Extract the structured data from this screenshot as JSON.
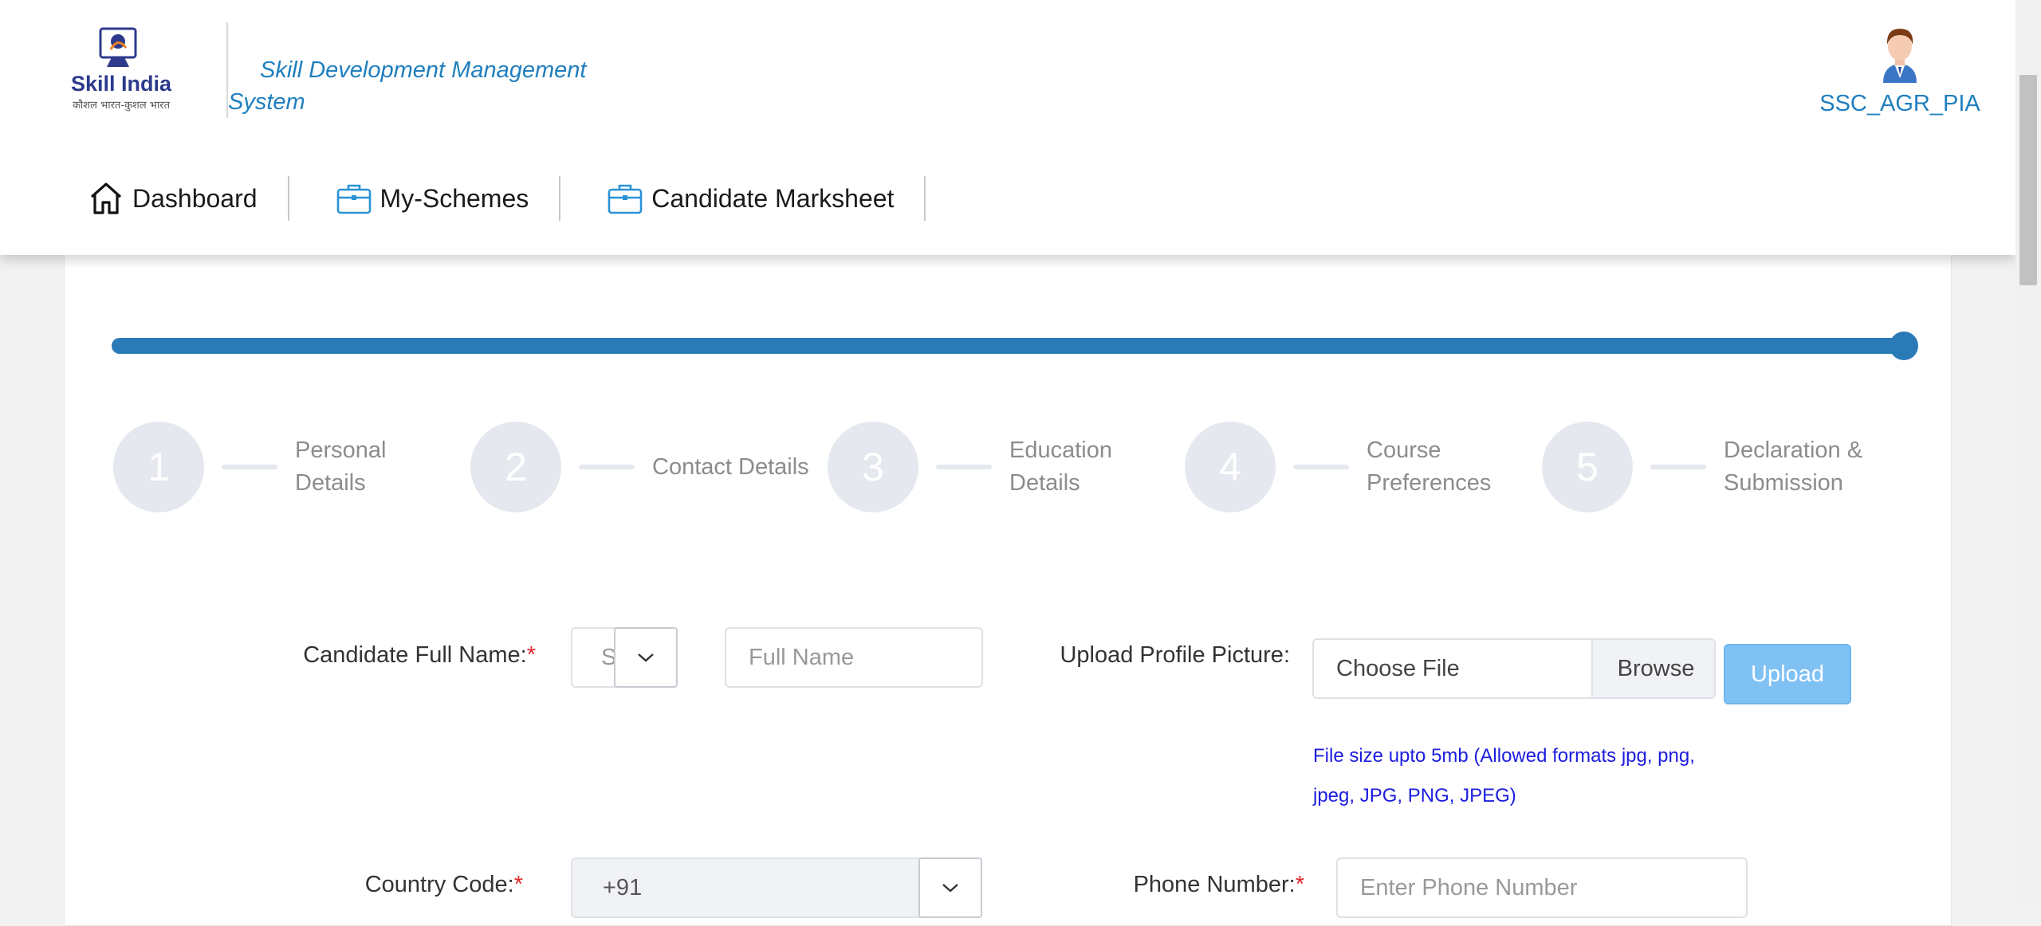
{
  "header": {
    "app_title": "Skill Development Management System",
    "logo_text": "Skill India",
    "logo_subtext": "कौशल भारत-कुशल भारत",
    "user_name": "SSC_AGR_PIA"
  },
  "nav": {
    "items": [
      {
        "label": "Dashboard",
        "icon": "home-icon"
      },
      {
        "label": "My-Schemes",
        "icon": "briefcase-icon"
      },
      {
        "label": "Candidate Marksheet",
        "icon": "briefcase-icon"
      }
    ]
  },
  "progress": {
    "percent": 100
  },
  "steps": [
    {
      "number": "1",
      "label": "Personal Details"
    },
    {
      "number": "2",
      "label": "Contact Details"
    },
    {
      "number": "3",
      "label": "Education Details"
    },
    {
      "number": "4",
      "label": "Course Preferences"
    },
    {
      "number": "5",
      "label": "Declaration & Submission"
    }
  ],
  "form": {
    "full_name_label": "Candidate Full Name:",
    "required_mark": "*",
    "salutation_value": "S",
    "full_name_placeholder": "Full Name",
    "profile_picture_label": "Upload Profile Picture:",
    "choose_file_text": "Choose File",
    "browse_label": "Browse",
    "upload_label": "Upload",
    "file_hint": "File size upto 5mb (Allowed formats jpg, png, jpeg, JPG, PNG, JPEG)",
    "country_code_label": "Country Code:",
    "country_code_value": "+91",
    "phone_label": "Phone Number:",
    "phone_placeholder": "Enter Phone Number"
  },
  "colors": {
    "accent": "#2a7ab7",
    "title_blue": "#1f7fbf",
    "required": "#e0262a",
    "hint_blue": "#1c1ce0",
    "upload_button": "#80c1f4"
  }
}
